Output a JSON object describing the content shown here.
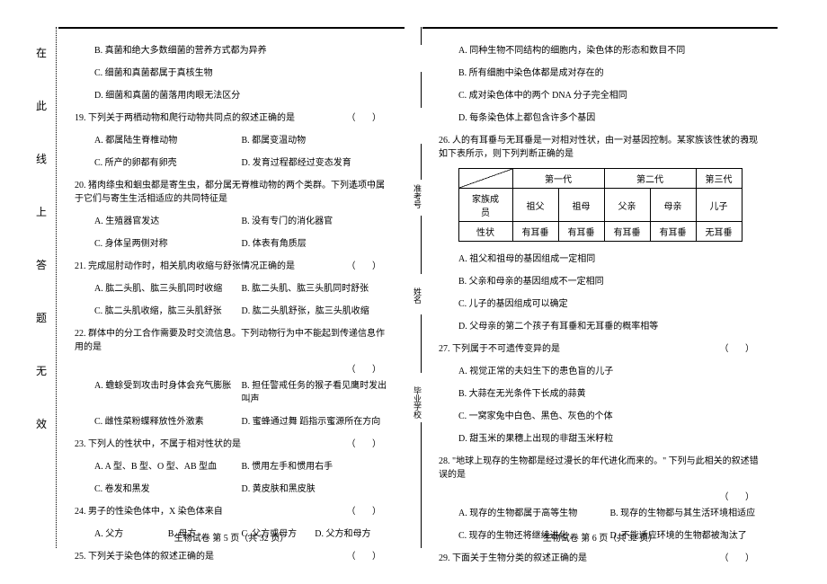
{
  "margin": [
    "在",
    "此",
    "线",
    "上",
    "答",
    "题",
    "无",
    "效"
  ],
  "vertical_labels": [
    "准考号",
    "姓名",
    "毕业学校"
  ],
  "left": {
    "items": [
      {
        "type": "opt",
        "indent": "indent1",
        "text": "B. 真菌和绝大多数细菌的营养方式都为异养"
      },
      {
        "type": "opt",
        "indent": "indent1",
        "text": "C. 细菌和真菌都属于真核生物"
      },
      {
        "type": "opt",
        "indent": "indent1",
        "text": "D. 细菌和真菌的菌落用肉眼无法区分"
      },
      {
        "type": "q",
        "num": "19.",
        "text": "下列关于两栖动物和爬行动物共同点的叙述正确的是",
        "br": true
      },
      {
        "type": "row2",
        "a": "A. 都属陆生脊椎动物",
        "b": "B. 都属变温动物"
      },
      {
        "type": "row2",
        "a": "C. 所产的卵都有卵壳",
        "b": "D. 发育过程都经过变态发育"
      },
      {
        "type": "q",
        "num": "20.",
        "text": "猪肉绦虫和蛔虫都是寄生虫，都分属无脊椎动物的两个类群。下列选项中属于它们与寄生生活相适应的共同特征是",
        "br": true
      },
      {
        "type": "row2",
        "a": "A. 生殖器官发达",
        "b": "B. 没有专门的消化器官"
      },
      {
        "type": "row2",
        "a": "C. 身体呈两侧对称",
        "b": "D. 体表有角质层"
      },
      {
        "type": "q",
        "num": "21.",
        "text": "完成屈肘动作时，相关肌肉收缩与舒张情况正确的是",
        "br": true
      },
      {
        "type": "row2",
        "a": "A. 肱二头肌、肱三头肌同时收缩",
        "b": "B. 肱二头肌、肱三头肌同时舒张"
      },
      {
        "type": "row2",
        "a": "C. 肱二头肌收缩，肱三头肌舒张",
        "b": "D. 肱二头肌舒张，肱三头肌收缩"
      },
      {
        "type": "q",
        "num": "22.",
        "text": "群体中的分工合作需要及时交流信息。下列动物行为中不能起到传递信息作用的是",
        "br_newline": true
      },
      {
        "type": "row2",
        "a": "A. 蟾蜍受到攻击时身体会充气膨胀",
        "b": "B. 担任警戒任务的猴子看见鹰时发出叫声"
      },
      {
        "type": "row2",
        "a": "C. 雌性菜粉蝶释放性外激素",
        "b": "D. 蜜蜂通过舞 蹈指示蜜源所在方向"
      },
      {
        "type": "q",
        "num": "23.",
        "text": "下列人的性状中，不属于相对性状的是",
        "br": true
      },
      {
        "type": "row2",
        "a": "A. A 型、B 型、O 型、AB 型血",
        "b": "B. 惯用左手和惯用右手"
      },
      {
        "type": "row2",
        "a": "C. 卷发和黑发",
        "b": "D. 黄皮肤和黑皮肤"
      },
      {
        "type": "q",
        "num": "24.",
        "text": "男子的性染色体中，X 染色体来自",
        "br": true
      },
      {
        "type": "row4",
        "a": "A. 父方",
        "b": "B. 母方",
        "c": "C. 父方或母方",
        "d": "D. 父方和母方"
      },
      {
        "type": "q",
        "num": "25.",
        "text": "下列关于染色体的叙述正确的是",
        "br": true
      }
    ],
    "footer": "生物试卷  第 5 页（共 32 页）"
  },
  "right": {
    "items": [
      {
        "type": "opt",
        "indent": "indent1",
        "text": "A. 同种生物不同结构的细胞内，染色体的形态和数目不同"
      },
      {
        "type": "opt",
        "indent": "indent1",
        "text": "B. 所有细胞中染色体都是成对存在的"
      },
      {
        "type": "opt",
        "indent": "indent1",
        "text": "C. 成对染色体中的两个 DNA 分子完全相同"
      },
      {
        "type": "opt",
        "indent": "indent1",
        "text": "D. 每条染色体上都包含许多个基因"
      },
      {
        "type": "q",
        "num": "26.",
        "text": "人的有耳垂与无耳垂是一对相对性状，由一对基因控制。某家族该性状的表现如下表所示，则下列判断正确的是",
        "br": true
      },
      {
        "type": "table"
      },
      {
        "type": "opt",
        "indent": "indent1",
        "text": "A. 祖父和祖母的基因组成一定相同"
      },
      {
        "type": "opt",
        "indent": "indent1",
        "text": "B. 父亲和母亲的基因组成不一定相同"
      },
      {
        "type": "opt",
        "indent": "indent1",
        "text": "C. 儿子的基因组成可以确定"
      },
      {
        "type": "opt",
        "indent": "indent1",
        "text": "D. 父母亲的第二个孩子有耳垂和无耳垂的概率相等"
      },
      {
        "type": "q",
        "num": "27.",
        "text": "下列属于不可遗传变异的是",
        "br": true
      },
      {
        "type": "opt",
        "indent": "indent1",
        "text": "A. 视觉正常的夫妇生下的患色盲的儿子"
      },
      {
        "type": "opt",
        "indent": "indent1",
        "text": "B. 大蒜在无光条件下长成的蒜黄"
      },
      {
        "type": "opt",
        "indent": "indent1",
        "text": "C. 一窝家兔中白色、黑色、灰色的个体"
      },
      {
        "type": "opt",
        "indent": "indent1",
        "text": "D. 甜玉米的果穗上出现的非甜玉米籽粒"
      },
      {
        "type": "q",
        "num": "28.",
        "text": "\"地球上现存的生物都是经过漫长的年代进化而来的。\" 下列与此相关的叙述错误的是",
        "br_newline": true
      },
      {
        "type": "row2",
        "a": "A. 现存的生物都属于高等生物",
        "b": "B. 现存的生物都与其生活环境相适应"
      },
      {
        "type": "row2",
        "a": "C. 现存的生物还将继续进化",
        "b": "D. 不能适应环境的生物都被淘汰了"
      },
      {
        "type": "q",
        "num": "29.",
        "text": "下面关于生物分类的叙述正确的是",
        "br": true
      }
    ],
    "table": {
      "gen1": "第一代",
      "gen2": "第二代",
      "gen3": "第三代",
      "rowh_member": "家族成员",
      "rowh_trait": "性状",
      "members": [
        "祖父",
        "祖母",
        "父亲",
        "母亲",
        "儿子"
      ],
      "traits": [
        "有耳垂",
        "有耳垂",
        "有耳垂",
        "有耳垂",
        "无耳垂"
      ]
    },
    "footer": "生物试卷  第 6 页（共 32 页）"
  },
  "bracket_text": "（  ）"
}
